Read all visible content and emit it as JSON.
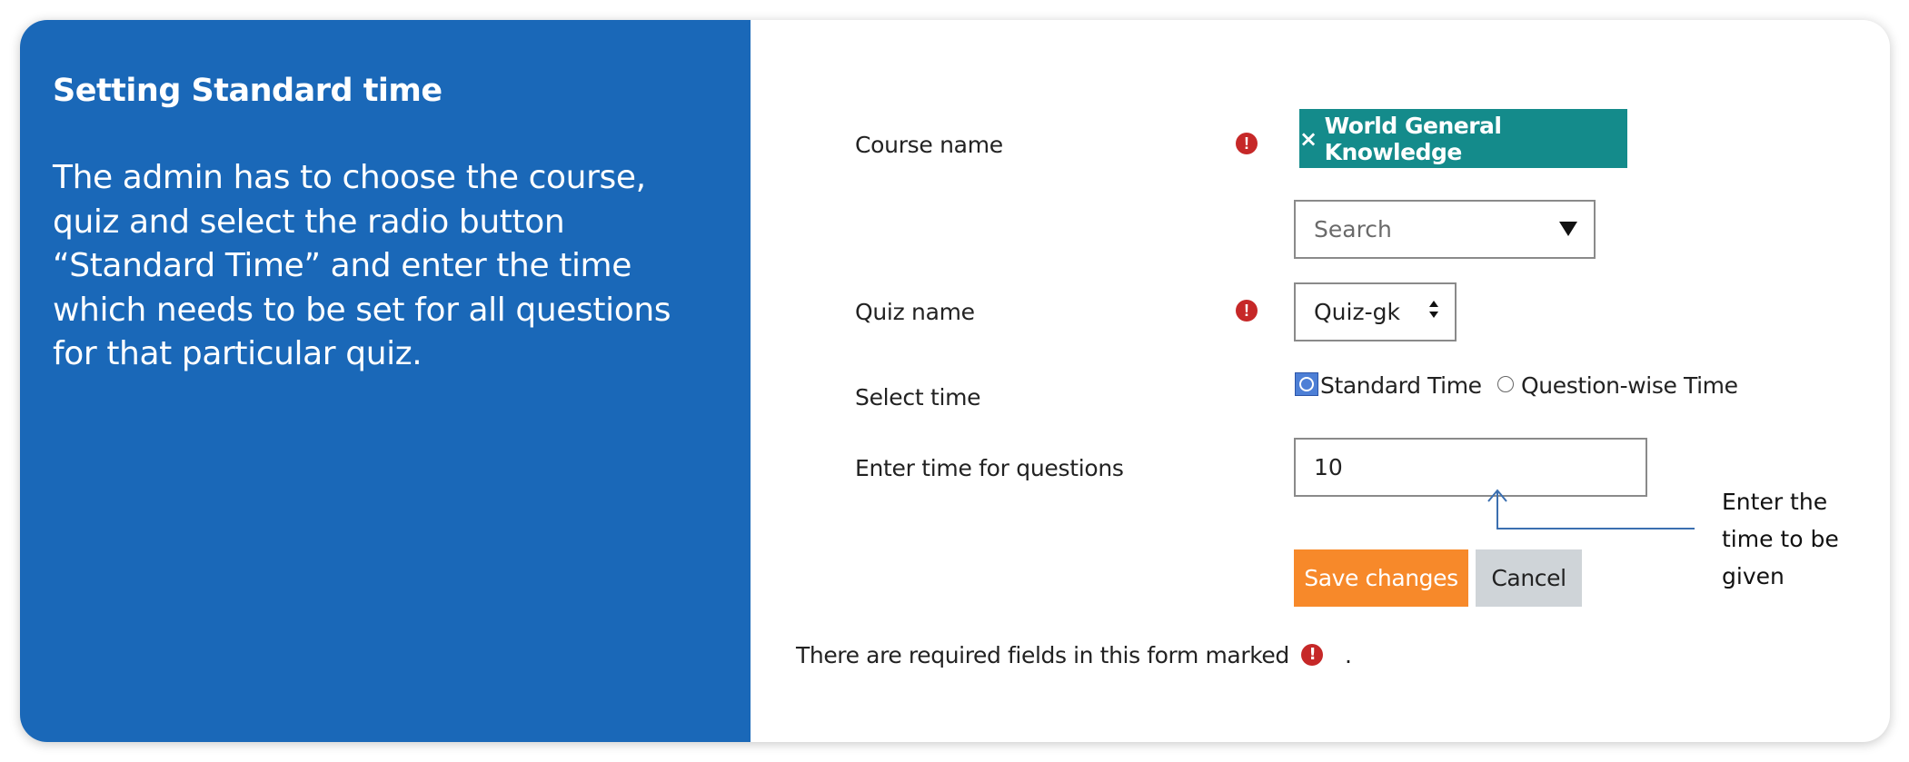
{
  "info_panel": {
    "title": "Setting Standard time",
    "description": "The admin has to choose the course, quiz and select the radio button “Standard Time” and enter the time which needs to be set for all questions for that particular quiz."
  },
  "form": {
    "course_label": "Course name",
    "course_chip": "World General Knowledge",
    "course_chip_remove": "×",
    "search_placeholder": "Search",
    "quiz_label": "Quiz name",
    "quiz_value": "Quiz-gk",
    "select_time_label": "Select time",
    "radio_options": [
      {
        "label": "Standard Time",
        "selected": true
      },
      {
        "label": "Question-wise Time",
        "selected": false
      }
    ],
    "time_label": "Enter time for questions",
    "time_value": "10",
    "save_label": "Save changes",
    "cancel_label": "Cancel",
    "required_icon": "!",
    "required_note": "There are required fields in this form marked",
    "required_note_end": "."
  },
  "annotation": {
    "text": "Enter the time to be given"
  },
  "colors": {
    "panel_blue": "#1a68b8",
    "chip_teal": "#148b8b",
    "save_orange": "#f7892a",
    "cancel_gray": "#cfd4d8",
    "required_red": "#c62828",
    "arrow_blue": "#3b6fb0"
  }
}
